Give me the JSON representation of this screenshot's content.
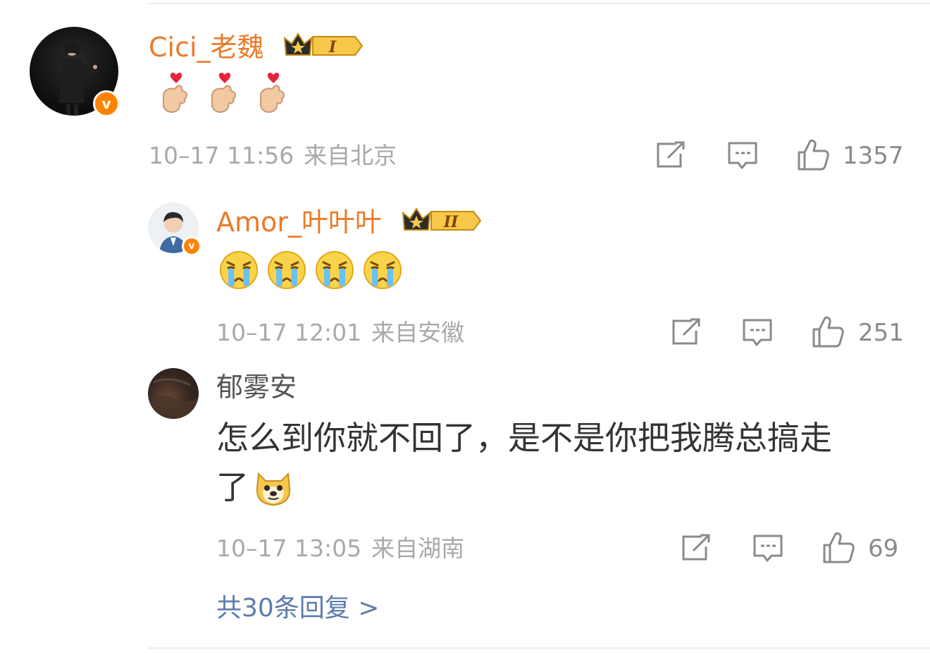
{
  "comments": [
    {
      "username": "Cici_老魏",
      "level_badge": "I",
      "emojis": [
        "finger-heart-emoji",
        "finger-heart-emoji",
        "finger-heart-emoji"
      ],
      "time": "10–17 11:56",
      "location": "来自北京",
      "likes": "1357"
    },
    {
      "username": "Amor_叶叶叶",
      "level_badge": "II",
      "emojis": [
        "crying-face-emoji",
        "crying-face-emoji",
        "crying-face-emoji",
        "crying-face-emoji"
      ],
      "time": "10–17 12:01",
      "location": "来自安徽",
      "likes": "251"
    },
    {
      "username": "郁雾安",
      "text_line1": "怎么到你就不回了，是不是你把我腾总搞走",
      "text_line2": "了",
      "emojis": [
        "doge-emoji"
      ],
      "time": "10–17 13:05",
      "location": "来自湖南",
      "likes": "69"
    }
  ],
  "more_replies": "共30条回复 >",
  "verified_badge": "v",
  "colors": {
    "username": "#ec7a28",
    "meta": "#a9a9a9",
    "link": "#5b7dab",
    "badge": "#ff8200"
  }
}
